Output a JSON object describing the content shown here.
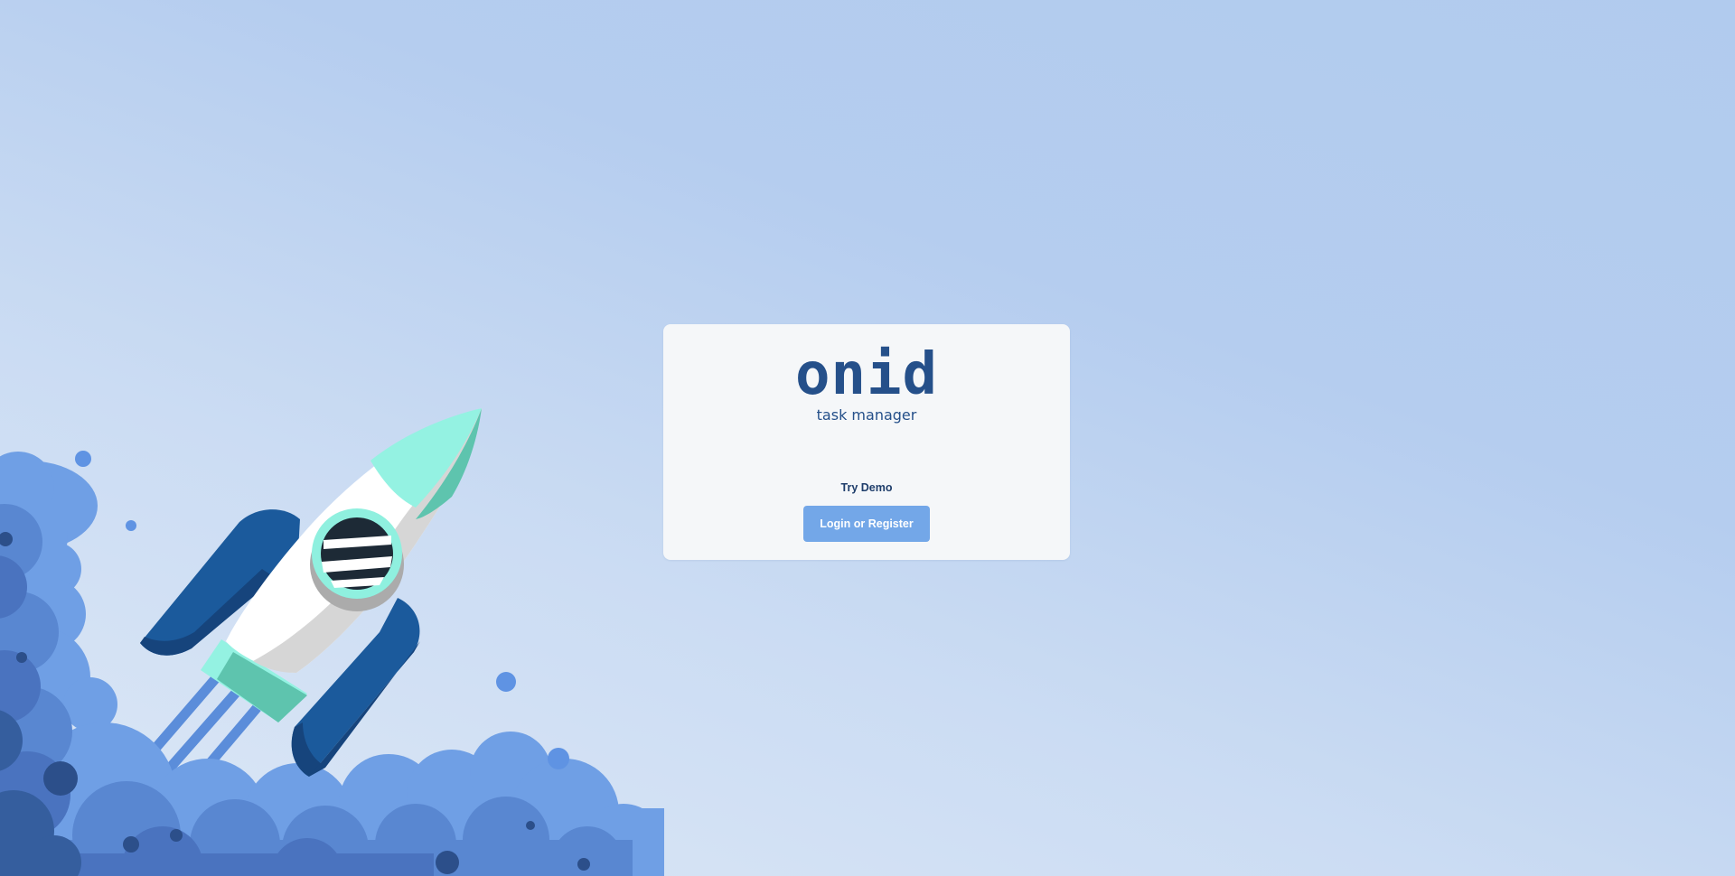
{
  "brand": {
    "logo_text": "onid",
    "subtitle": "task manager"
  },
  "actions": {
    "demo_label": "Try Demo",
    "login_label": "Login or Register"
  },
  "illustration": {
    "icon": "rocket-launch-icon"
  },
  "colors": {
    "brand": "#25508a",
    "button": "#73a7e8",
    "card": "#f5f7f9",
    "rocket_accent": "#94f2e2",
    "rocket_dark": "#1a5596"
  }
}
